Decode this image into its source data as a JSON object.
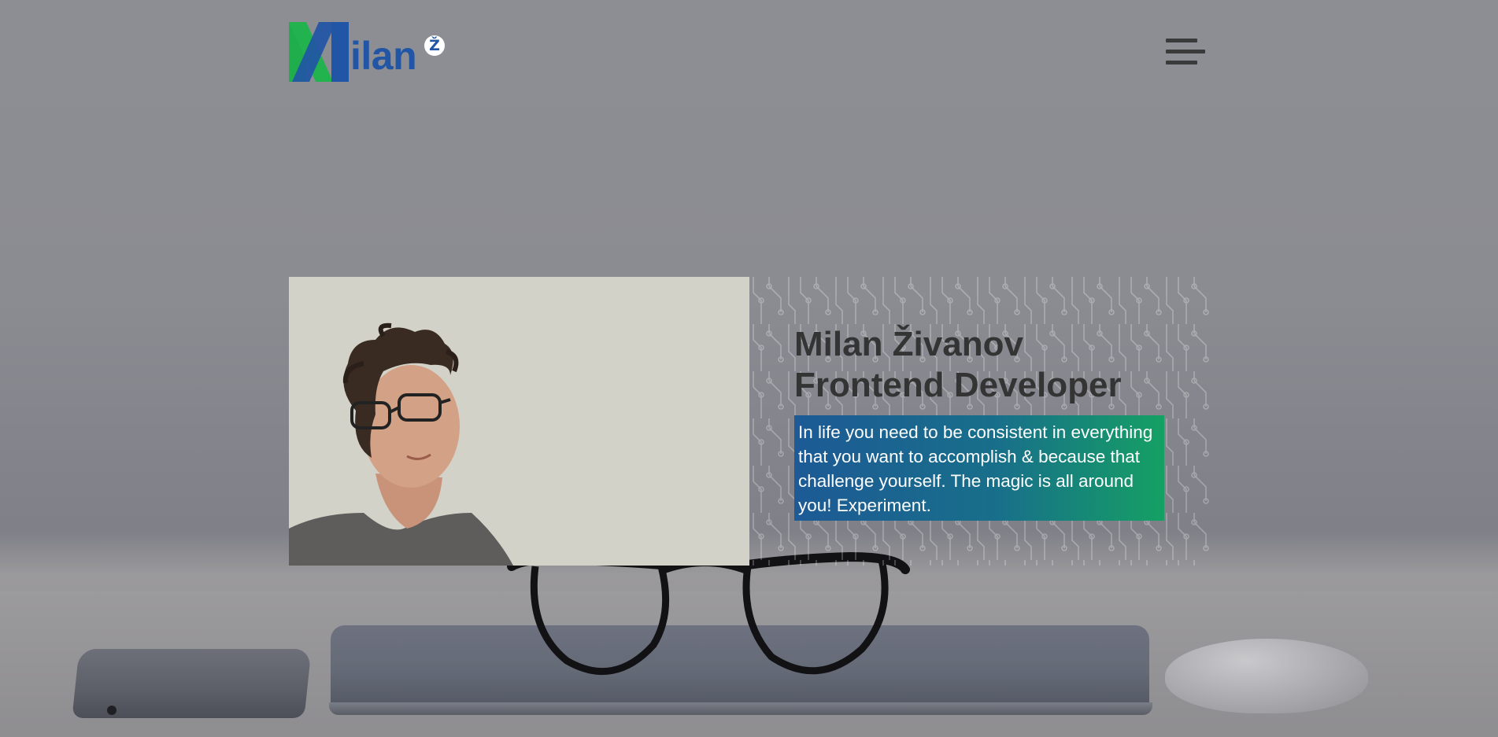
{
  "header": {
    "logo_text": "ilan",
    "logo_badge": "Ž",
    "menu_icon": "hamburger-menu-icon"
  },
  "intro": {
    "name_line": "Milan Živanov",
    "role_line": "Frontend Developer",
    "quote": "In life you need to be consistent in everything that you want to accomplish & because that challenge yourself. The magic is all around you! Experiment."
  },
  "colors": {
    "brand_blue": "#2155a5",
    "brand_green": "#1fae4b",
    "quote_gradient_start": "#1d5a96",
    "quote_gradient_end": "#15a064",
    "heading_text": "#343434"
  }
}
